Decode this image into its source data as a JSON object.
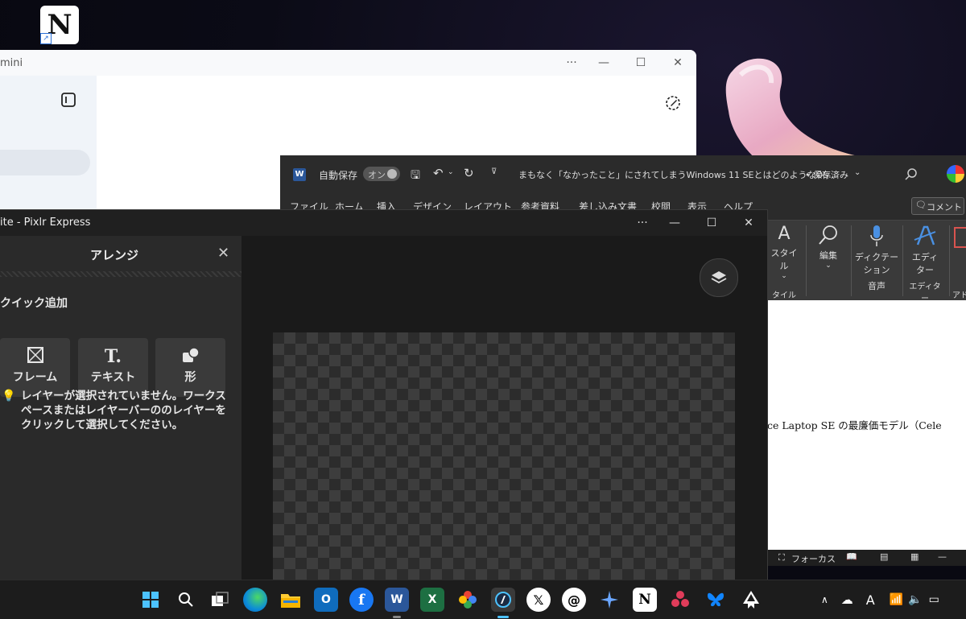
{
  "desktop": {
    "icon_label": "N"
  },
  "gemini": {
    "title": "mini",
    "controls": {
      "more": "···",
      "minimize": "—",
      "maximize": "☐",
      "close": "✕"
    }
  },
  "word": {
    "autosave_label": "自動保存",
    "autosave_state": "オン",
    "doc_title": "まもなく「なかったこと」にされてしまうWindows 11 SEとはどのようなOS…",
    "save_status": "• 保存済み",
    "menu": [
      "ファイル",
      "ホーム",
      "挿入",
      "デザイン",
      "レイアウト",
      "参考資料",
      "差し込み文書",
      "校閲",
      "表示",
      "ヘルプ"
    ],
    "comment_button": "コメント",
    "ribbon": {
      "style_label": "スタイル",
      "style_group": "タイル",
      "edit_label": "編集",
      "dictation_label_1": "ディクテー",
      "dictation_label_2": "ション",
      "voice_group": "音声",
      "editor_label_1": "エディ",
      "editor_label_2": "ター",
      "editor_group": "エディター",
      "addin_group": "アド"
    },
    "doc_text": "ce Laptop SE の最廉価モデル（Cele",
    "status_focus": "フォーカス"
  },
  "pixlr": {
    "title": "ite - Pixlr Express",
    "panel_title": "アレンジ",
    "quick_add": "クイック追加",
    "tiles": [
      {
        "label": "フレーム",
        "icon": "frame-icon"
      },
      {
        "label": "テキスト",
        "icon": "text-icon"
      },
      {
        "label": "形",
        "icon": "shape-icon"
      }
    ],
    "hint": "レイヤーが選択されていません。ワークスペースまたはレイヤーバーののレイヤーをクリックして選択してください。",
    "controls": {
      "more": "···",
      "minimize": "—",
      "maximize": "☐",
      "close": "✕"
    }
  },
  "taskbar": {
    "apps": [
      "start",
      "search",
      "task-view",
      "edge",
      "file-explorer",
      "outlook",
      "facebook",
      "word",
      "excel",
      "photos",
      "pixlr",
      "x",
      "threads",
      "copilot",
      "notion",
      "davinci",
      "bluesky",
      "inkscape"
    ]
  },
  "colors": {
    "accent_blue": "#4cc2ff",
    "word_blue": "#2b579a",
    "excel_green": "#1d6f42"
  }
}
